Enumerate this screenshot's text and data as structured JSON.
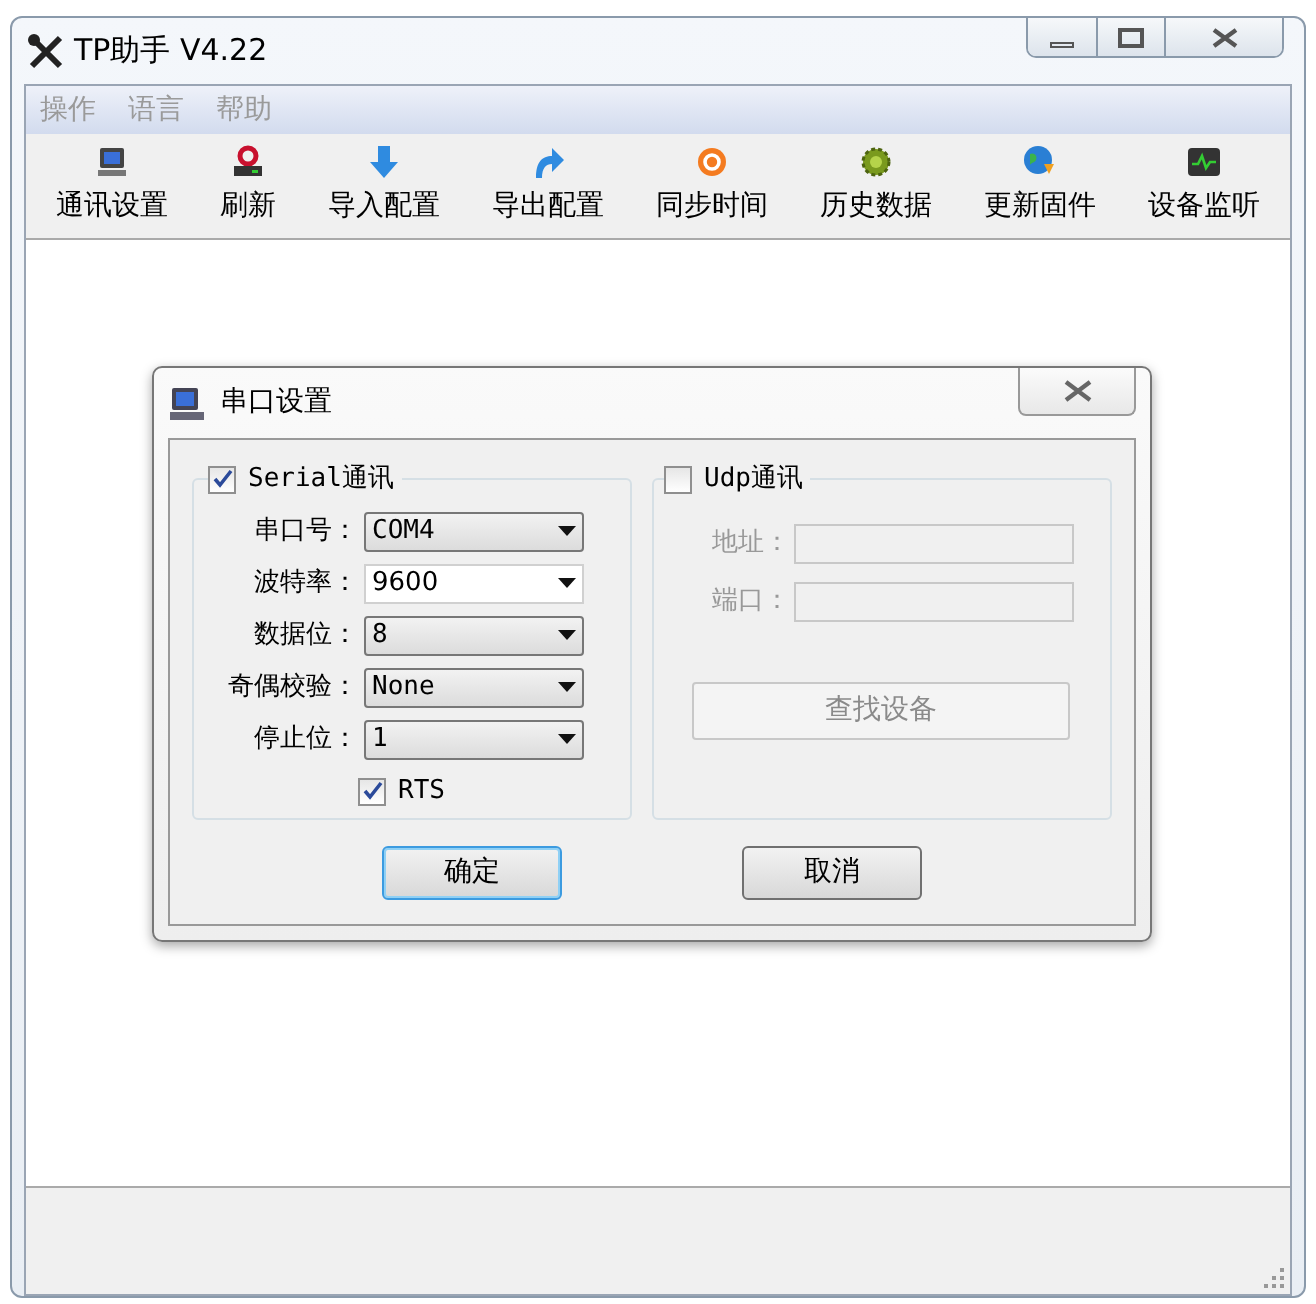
{
  "window": {
    "title": "TP助手 V4.22"
  },
  "menu": [
    {
      "label": "操作",
      "disabled": true
    },
    {
      "label": "语言",
      "disabled": true
    },
    {
      "label": "帮助",
      "disabled": true
    }
  ],
  "toolbar": [
    {
      "label": "通讯设置",
      "kind": "computer"
    },
    {
      "label": "刷新",
      "kind": "disk"
    },
    {
      "label": "导入配置",
      "kind": "down"
    },
    {
      "label": "导出配置",
      "kind": "export"
    },
    {
      "label": "同步时间",
      "kind": "sync"
    },
    {
      "label": "历史数据",
      "kind": "gear"
    },
    {
      "label": "更新固件",
      "kind": "globe"
    },
    {
      "label": "设备监听",
      "kind": "monitor"
    }
  ],
  "dialog": {
    "title": "串口设置",
    "serial": {
      "label": "Serial通讯",
      "checked": true,
      "fields": [
        {
          "label": "串口号：",
          "value": "COM4",
          "kind": "dropdown"
        },
        {
          "label": "波特率：",
          "value": "9600",
          "kind": "combo"
        },
        {
          "label": "数据位：",
          "value": "8",
          "kind": "dropdown"
        },
        {
          "label": "奇偶校验：",
          "value": "None",
          "kind": "dropdown"
        },
        {
          "label": "停止位：",
          "value": "1",
          "kind": "dropdown"
        }
      ],
      "rts": {
        "label": "RTS",
        "checked": true
      }
    },
    "udp": {
      "label": "Udp通讯",
      "checked": false,
      "fields": [
        {
          "label": "地址：",
          "disabled": true
        },
        {
          "label": "端口：",
          "disabled": true
        }
      ],
      "search_button": {
        "label": "查找设备",
        "disabled": true
      }
    },
    "buttons": [
      {
        "label": "确定",
        "selected": true
      },
      {
        "label": "取消",
        "selected": false
      }
    ]
  }
}
